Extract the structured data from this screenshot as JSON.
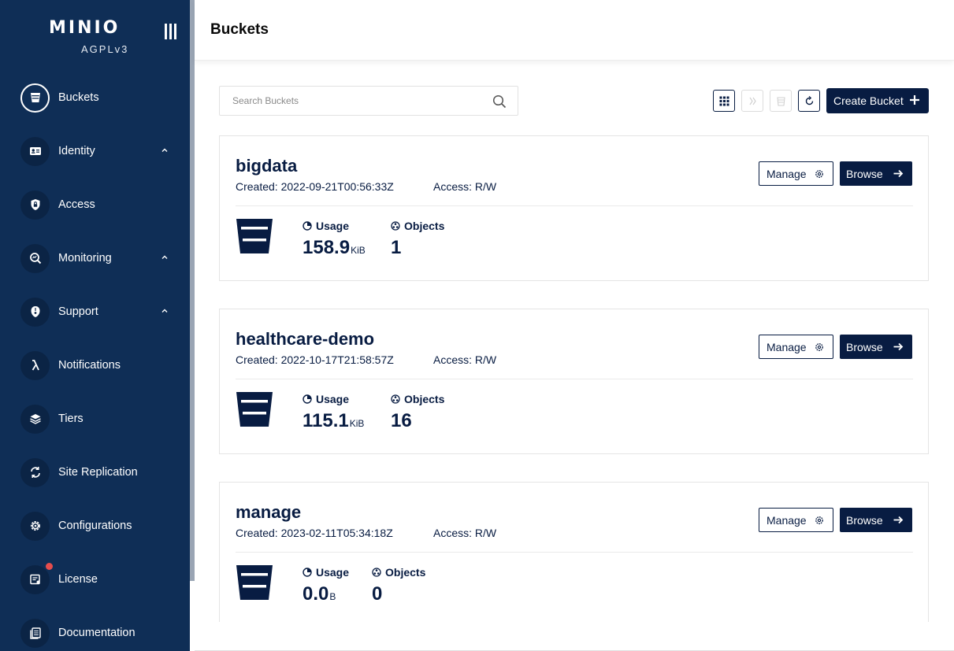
{
  "brand": {
    "logo": "MINIO",
    "license": "AGPLv3"
  },
  "sidebar": {
    "items": [
      {
        "label": "Buckets",
        "icon": "bucket-icon",
        "active": true,
        "chevron": false
      },
      {
        "label": "Identity",
        "icon": "identity-card-icon",
        "chevron": true
      },
      {
        "label": "Access",
        "icon": "lock-shield-icon",
        "chevron": false
      },
      {
        "label": "Monitoring",
        "icon": "magnifier-chart-icon",
        "chevron": true
      },
      {
        "label": "Support",
        "icon": "support-icon",
        "chevron": true
      },
      {
        "label": "Notifications",
        "icon": "lambda-icon",
        "chevron": false
      },
      {
        "label": "Tiers",
        "icon": "layers-icon",
        "chevron": false
      },
      {
        "label": "Site Replication",
        "icon": "sync-icon",
        "chevron": false
      },
      {
        "label": "Configurations",
        "icon": "gear-icon",
        "chevron": false
      },
      {
        "label": "License",
        "icon": "license-icon",
        "badge": true,
        "chevron": false
      },
      {
        "label": "Documentation",
        "icon": "documentation-icon",
        "chevron": false
      }
    ]
  },
  "header": {
    "title": "Buckets"
  },
  "toolbar": {
    "search_placeholder": "Search Buckets",
    "create_label": "Create Bucket"
  },
  "buckets": [
    {
      "name": "bigdata",
      "created": "Created: 2022-09-21T00:56:33Z",
      "access": "Access: R/W",
      "usage_label": "Usage",
      "usage_value": "158.9",
      "usage_unit": "KiB",
      "objects_label": "Objects",
      "objects_value": "1",
      "manage_label": "Manage",
      "browse_label": "Browse"
    },
    {
      "name": "healthcare-demo",
      "created": "Created: 2022-10-17T21:58:57Z",
      "access": "Access: R/W",
      "usage_label": "Usage",
      "usage_value": "115.1",
      "usage_unit": "KiB",
      "objects_label": "Objects",
      "objects_value": "16",
      "manage_label": "Manage",
      "browse_label": "Browse"
    },
    {
      "name": "manage",
      "created": "Created: 2023-02-11T05:34:18Z",
      "access": "Access: R/W",
      "usage_label": "Usage",
      "usage_value": "0.0",
      "usage_unit": "B",
      "objects_label": "Objects",
      "objects_value": "0",
      "manage_label": "Manage",
      "browse_label": "Browse"
    }
  ],
  "colors": {
    "sidebar": "#0f2e56",
    "primary": "#081c42",
    "badge": "#e54d4d"
  }
}
